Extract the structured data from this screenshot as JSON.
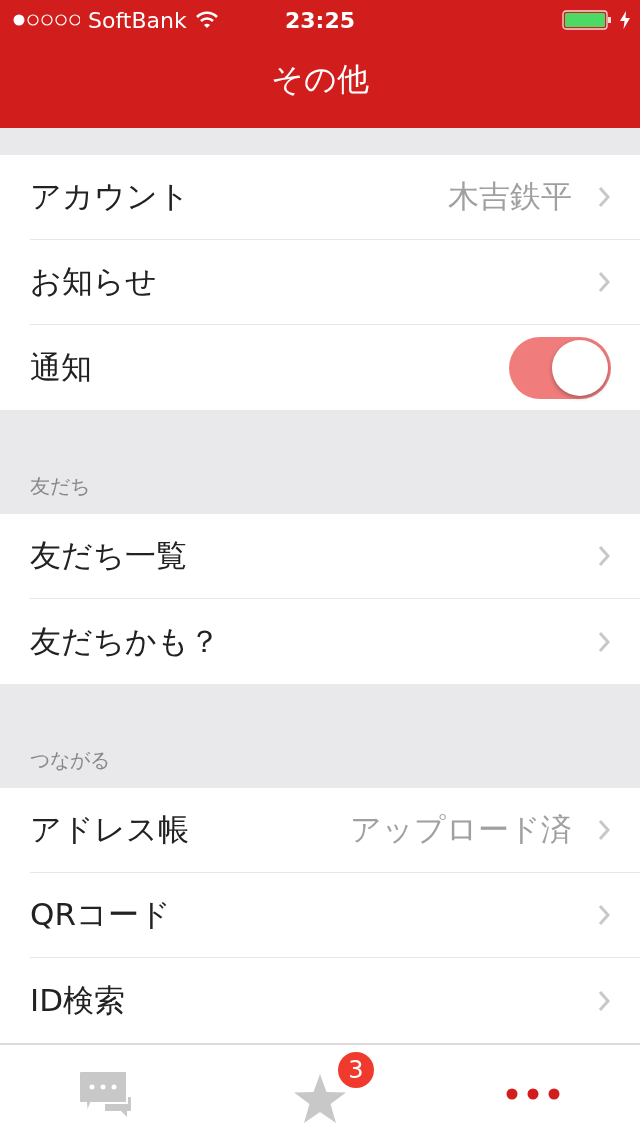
{
  "status_bar": {
    "carrier": "SoftBank",
    "time": "23:25"
  },
  "nav_bar": {
    "title": "その他"
  },
  "sections": [
    {
      "rows": [
        {
          "kind": "link",
          "label": "アカウント",
          "value": "木吉鉄平"
        },
        {
          "kind": "link",
          "label": "お知らせ"
        },
        {
          "kind": "toggle",
          "label": "通知",
          "on": true
        }
      ]
    },
    {
      "header": "友だち",
      "rows": [
        {
          "kind": "link",
          "label": "友だち一覧"
        },
        {
          "kind": "link",
          "label": "友だちかも？"
        }
      ]
    },
    {
      "header": "つながる",
      "rows": [
        {
          "kind": "link",
          "label": "アドレス帳",
          "value": "アップロード済"
        },
        {
          "kind": "link",
          "label": "QRコード"
        },
        {
          "kind": "link",
          "label": "ID検索"
        }
      ]
    }
  ],
  "tab_bar": [
    {
      "kind": "chat",
      "selected": false
    },
    {
      "kind": "star",
      "selected": false,
      "badge": "3"
    },
    {
      "kind": "more",
      "selected": true
    }
  ]
}
